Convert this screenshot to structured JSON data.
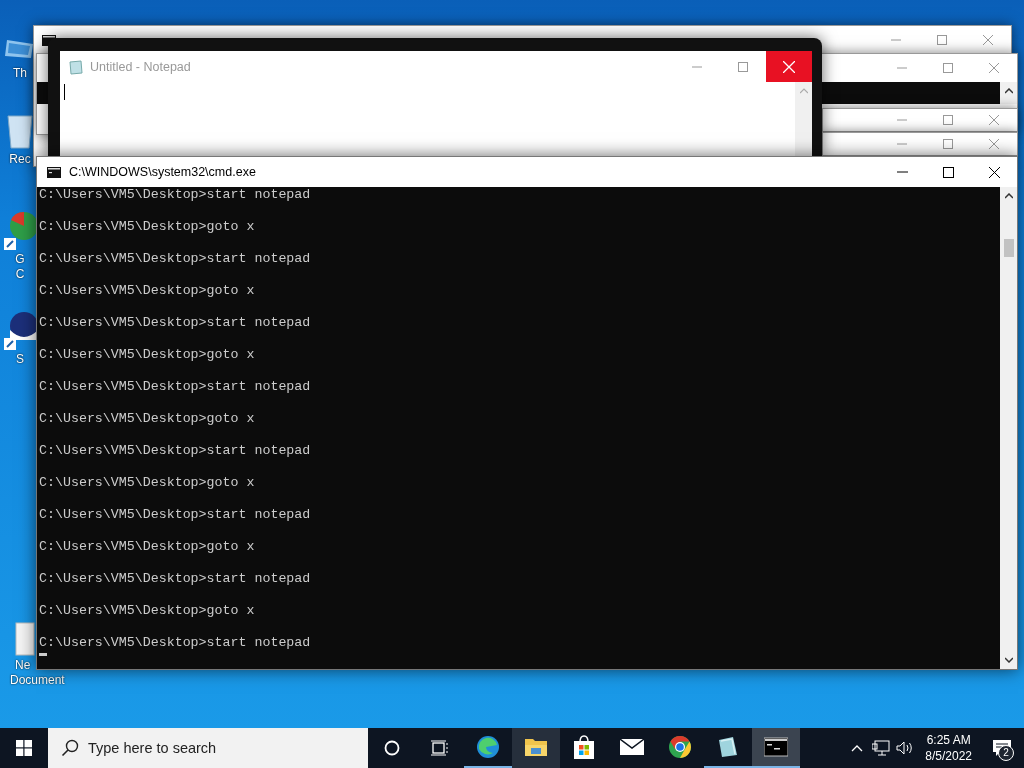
{
  "desktop_icons": [
    {
      "kind": "pc",
      "lines": [
        "Th"
      ]
    },
    {
      "kind": "bin",
      "lines": [
        "Rec"
      ]
    },
    {
      "kind": "chrome",
      "lines": [
        "G",
        "C"
      ]
    },
    {
      "kind": "app",
      "lines": [
        "S"
      ]
    },
    {
      "kind": "doc",
      "lines": [
        "Ne",
        "Document"
      ]
    }
  ],
  "background_windows": [
    {
      "kind": "cmd"
    },
    {
      "kind": "cmd-body"
    },
    {
      "kind": "bar"
    },
    {
      "kind": "bar"
    }
  ],
  "notepad": {
    "title": "Untitled - Notepad"
  },
  "cmd": {
    "title": "C:\\WINDOWS\\system32\\cmd.exe",
    "lines": [
      "C:\\Users\\VM5\\Desktop>start notepad",
      "C:\\Users\\VM5\\Desktop>goto x",
      "C:\\Users\\VM5\\Desktop>start notepad",
      "C:\\Users\\VM5\\Desktop>goto x",
      "C:\\Users\\VM5\\Desktop>start notepad",
      "C:\\Users\\VM5\\Desktop>goto x",
      "C:\\Users\\VM5\\Desktop>start notepad",
      "C:\\Users\\VM5\\Desktop>goto x",
      "C:\\Users\\VM5\\Desktop>start notepad",
      "C:\\Users\\VM5\\Desktop>goto x",
      "C:\\Users\\VM5\\Desktop>start notepad",
      "C:\\Users\\VM5\\Desktop>goto x",
      "C:\\Users\\VM5\\Desktop>start notepad",
      "C:\\Users\\VM5\\Desktop>goto x",
      "C:\\Users\\VM5\\Desktop>start notepad"
    ]
  },
  "taskbar": {
    "search": {
      "placeholder": "Type here to search"
    },
    "apps": [
      {
        "kind": "edge",
        "running": true,
        "hovered": false,
        "selected": false
      },
      {
        "kind": "explorer",
        "running": false,
        "hovered": true,
        "selected": false
      },
      {
        "kind": "store",
        "running": false,
        "hovered": false,
        "selected": false
      },
      {
        "kind": "mail",
        "running": false,
        "hovered": false,
        "selected": false
      },
      {
        "kind": "chrome",
        "running": false,
        "hovered": false,
        "selected": false
      },
      {
        "kind": "notepad",
        "running": true,
        "hovered": false,
        "selected": false
      },
      {
        "kind": "cmd",
        "running": true,
        "hovered": false,
        "selected": true
      }
    ],
    "time": "6:25 AM",
    "date": "8/5/2022",
    "notification_count": "2"
  }
}
